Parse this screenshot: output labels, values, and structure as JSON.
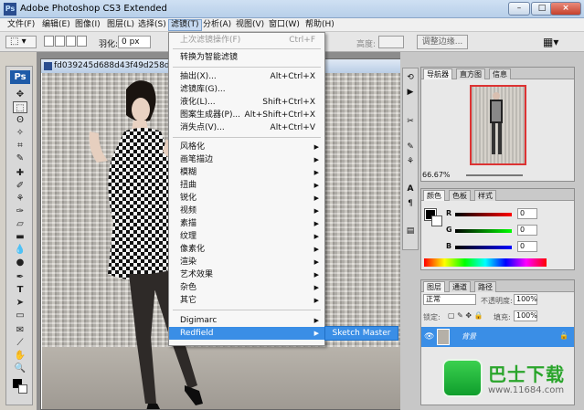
{
  "window": {
    "title": "Adobe Photoshop CS3 Extended",
    "app_icon": "Ps"
  },
  "menubar": {
    "items": [
      "文件(F)",
      "编辑(E)",
      "图像(I)",
      "图层(L)",
      "选择(S)",
      "滤镜(T)",
      "分析(A)",
      "视图(V)",
      "窗口(W)",
      "帮助(H)"
    ],
    "active": "滤镜(T)"
  },
  "options": {
    "feather_label": "羽化:",
    "feather_value": "0 px",
    "height_label": "高度:",
    "refine_edge": "调整边缘..."
  },
  "toolbox": {
    "logo": "Ps"
  },
  "document": {
    "title": "fd039245d688d43f49d258d478"
  },
  "filter_menu": {
    "last_filter": {
      "label": "上次滤镜操作(F)",
      "shortcut": "Ctrl+F"
    },
    "smart_filter": "转换为智能滤镜",
    "group1": [
      {
        "label": "抽出(X)...",
        "shortcut": "Alt+Ctrl+X"
      },
      {
        "label": "滤镜库(G)...",
        "shortcut": ""
      },
      {
        "label": "液化(L)...",
        "shortcut": "Shift+Ctrl+X"
      },
      {
        "label": "图案生成器(P)...",
        "shortcut": "Alt+Shift+Ctrl+X"
      },
      {
        "label": "消失点(V)...",
        "shortcut": "Alt+Ctrl+V"
      }
    ],
    "group2": [
      "风格化",
      "画笔描边",
      "模糊",
      "扭曲",
      "锐化",
      "视频",
      "素描",
      "纹理",
      "像素化",
      "渲染",
      "艺术效果",
      "杂色",
      "其它"
    ],
    "group3": [
      "Digimarc",
      "Redfield"
    ],
    "submenu": "Sketch Master"
  },
  "navigator": {
    "tabs": [
      "导航器",
      "直方图",
      "信息"
    ],
    "zoom": "66.67%"
  },
  "color_panel": {
    "tabs": [
      "颜色",
      "色板",
      "样式"
    ],
    "channels": [
      {
        "name": "R",
        "value": "0"
      },
      {
        "name": "G",
        "value": "0"
      },
      {
        "name": "B",
        "value": "0"
      }
    ]
  },
  "layers_panel": {
    "tabs": [
      "图层",
      "通道",
      "路径"
    ],
    "blend_mode": "正常",
    "opacity_label": "不透明度:",
    "opacity": "100%",
    "lock_label": "锁定:",
    "fill_label": "填充:",
    "fill": "100%",
    "layer_name": "背景"
  },
  "watermark": {
    "text": "巴士下载",
    "url": "www.11684.com"
  },
  "colors": {
    "accent": "#3a8ee6",
    "title_bar": "#b7cfe9"
  }
}
